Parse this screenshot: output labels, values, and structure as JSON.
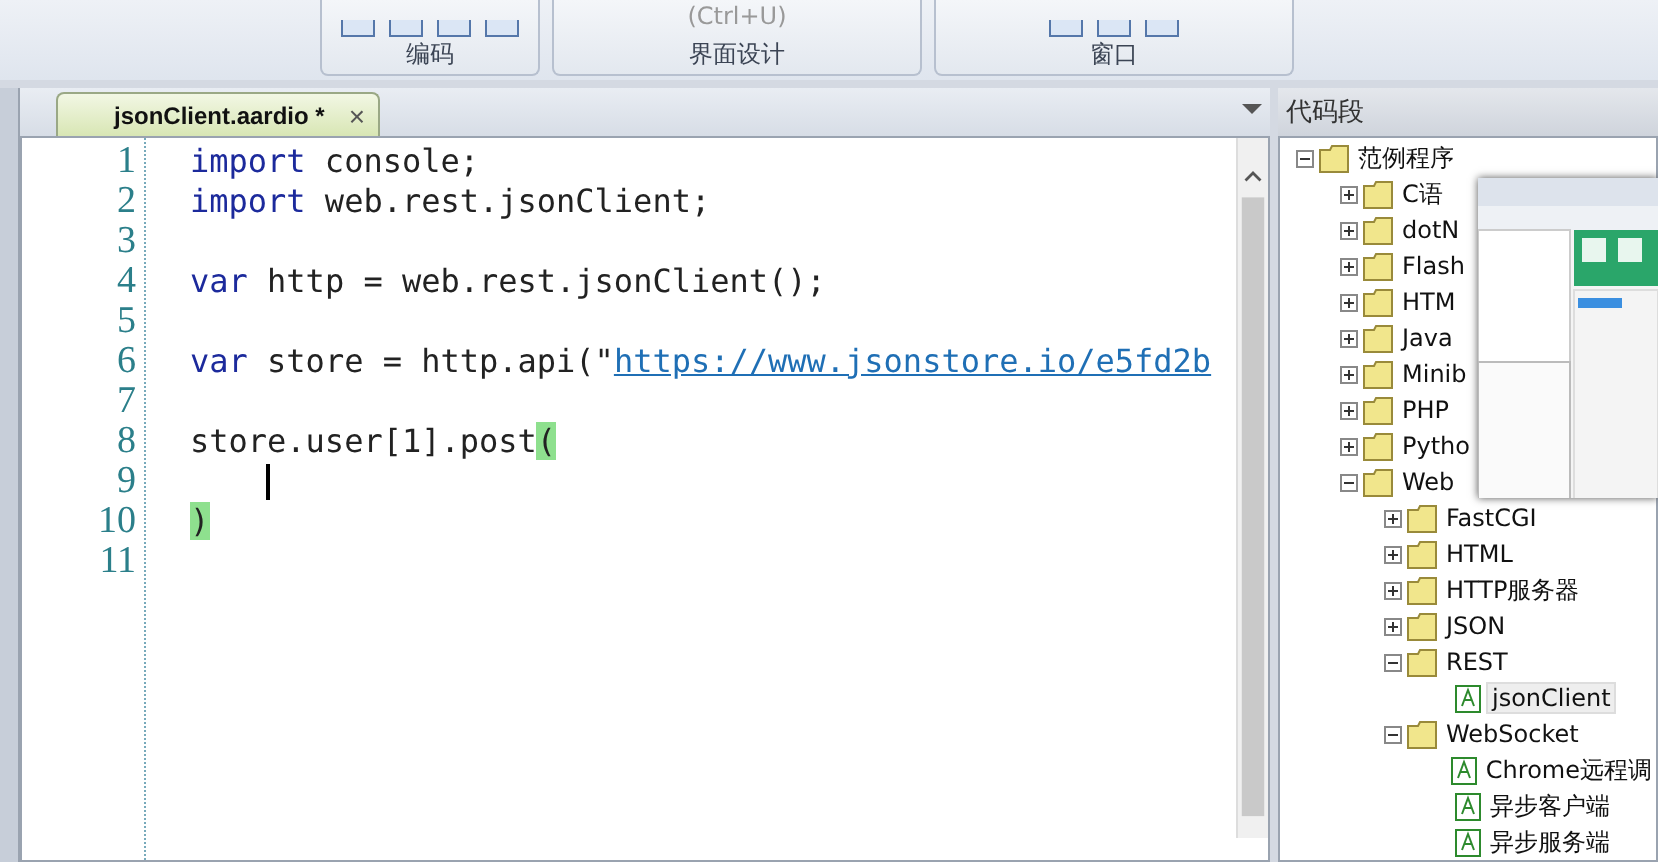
{
  "ribbon": {
    "groups": [
      {
        "label": "编码"
      },
      {
        "label": "界面设计",
        "hint": "(Ctrl+U)"
      },
      {
        "label": "窗口"
      }
    ]
  },
  "editor": {
    "tab": {
      "title": "jsonClient.aardio *",
      "selected": true,
      "close": "×"
    },
    "lines": [
      {
        "number": "1",
        "caret": false,
        "segments": [
          {
            "kind": "keyword",
            "text": "import"
          },
          {
            "kind": "plain",
            "text": " console;"
          }
        ]
      },
      {
        "number": "2",
        "caret": false,
        "segments": [
          {
            "kind": "keyword",
            "text": "import"
          },
          {
            "kind": "plain",
            "text": " web.rest.jsonClient;"
          }
        ]
      },
      {
        "number": "3",
        "caret": false
      },
      {
        "number": "4",
        "caret": false,
        "segments": [
          {
            "kind": "keyword",
            "text": "var"
          },
          {
            "kind": "plain",
            "text": " http = web.rest.jsonClient();"
          }
        ]
      },
      {
        "number": "5",
        "caret": false
      },
      {
        "number": "6",
        "caret": false,
        "segments": [
          {
            "kind": "keyword",
            "text": "var"
          },
          {
            "kind": "plain",
            "text": " store = http.api(\""
          },
          {
            "kind": "link",
            "text": "https://www.jsonstore.io/e5fd2b"
          }
        ]
      },
      {
        "number": "7",
        "caret": false
      },
      {
        "number": "8",
        "caret": false,
        "segments": [
          {
            "kind": "plain",
            "text": "store.user[1].post"
          },
          {
            "kind": "match",
            "text": "("
          }
        ]
      },
      {
        "number": "9",
        "caret": true
      },
      {
        "number": "10",
        "caret": false,
        "segments": [
          {
            "kind": "match",
            "text": ")"
          }
        ]
      },
      {
        "number": "11",
        "caret": false
      }
    ]
  },
  "snippets": {
    "title": "代码段",
    "tree": [
      {
        "label": "范例程序",
        "kind": "folder",
        "expanded": true,
        "selected": false,
        "children": [
          {
            "label": "C语",
            "kind": "folder",
            "expanded": false,
            "selected": false
          },
          {
            "label": "dotN",
            "kind": "folder",
            "expanded": false,
            "selected": false
          },
          {
            "label": "Flash",
            "kind": "folder",
            "expanded": false,
            "selected": false
          },
          {
            "label": "HTM",
            "kind": "folder",
            "expanded": false,
            "selected": false
          },
          {
            "label": "Java",
            "kind": "folder",
            "expanded": false,
            "selected": false
          },
          {
            "label": "Minib",
            "kind": "folder",
            "expanded": false,
            "selected": false
          },
          {
            "label": "PHP",
            "kind": "folder",
            "expanded": false,
            "selected": false
          },
          {
            "label": "Pytho",
            "kind": "folder",
            "expanded": false,
            "selected": false
          },
          {
            "label": "Web",
            "kind": "folder",
            "expanded": true,
            "selected": false,
            "children": [
              {
                "label": "FastCGI",
                "kind": "folder",
                "expanded": false,
                "selected": false
              },
              {
                "label": "HTML",
                "kind": "folder",
                "expanded": false,
                "selected": false
              },
              {
                "label": "HTTP服务器",
                "kind": "folder",
                "expanded": false,
                "selected": false
              },
              {
                "label": "JSON",
                "kind": "folder",
                "expanded": false,
                "selected": false
              },
              {
                "label": "REST",
                "kind": "folder",
                "expanded": true,
                "selected": false,
                "children": [
                  {
                    "label": "jsonClient",
                    "kind": "file",
                    "selected": true
                  }
                ]
              },
              {
                "label": "WebSocket",
                "kind": "folder",
                "expanded": true,
                "selected": false,
                "children": [
                  {
                    "label": "Chrome远程调",
                    "kind": "file",
                    "selected": false
                  },
                  {
                    "label": "异步客户端",
                    "kind": "file",
                    "selected": false
                  },
                  {
                    "label": "异步服务端",
                    "kind": "file",
                    "selected": false
                  }
                ]
              }
            ]
          }
        ]
      }
    ]
  }
}
